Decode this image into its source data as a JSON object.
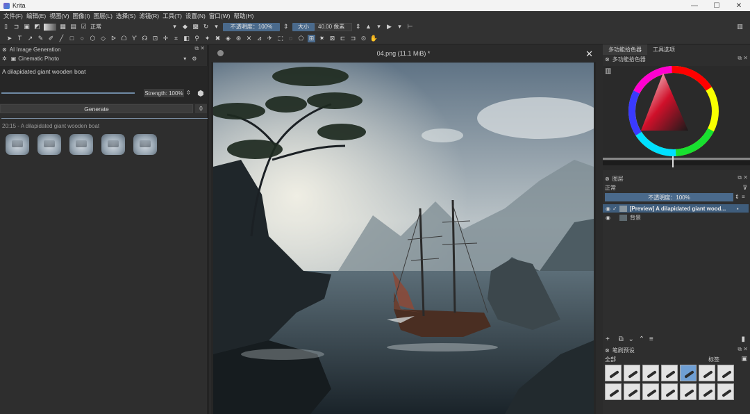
{
  "window": {
    "title": "Krita",
    "minimize": "—",
    "maximize": "☐",
    "close": "✕"
  },
  "menu": [
    "文件(F)",
    "编辑(E)",
    "视图(V)",
    "图像(I)",
    "图层(L)",
    "选择(S)",
    "滤镜(R)",
    "工具(T)",
    "设置(N)",
    "窗口(W)",
    "帮助(H)"
  ],
  "toolbar": {
    "blend_mode": "正常",
    "opacity_label": "不透明度：100%",
    "size_label": "大小",
    "size_value": "40.00 像素"
  },
  "ai_panel": {
    "title": "AI Image Generation",
    "style": "Cinematic Photo",
    "prompt": "A dilapidated giant wooden boat",
    "strength_label": "Strength: 100%",
    "generate_label": "Generate",
    "queue_count": "0",
    "history_label": "20:15 - A dilapidated giant wooden boat"
  },
  "document": {
    "tab_title": "04.png (11.1 MiB) *"
  },
  "right_panel": {
    "tab1": "多功能拾色器",
    "tab2": "工具选项",
    "selector_title": "多功能拾色器",
    "layers_title": "图层",
    "blend_mode": "正常",
    "opacity": "不透明度：100%",
    "layer1": "[Preview] A dilapidated giant wood...",
    "layer2": "背景",
    "brush_title": "笔刷预设",
    "brush_filter": "全部",
    "brush_tag": "标签"
  },
  "colors": {
    "accent": "#4a6a8c",
    "panel": "#2e2e2e",
    "selected_layer": "#3f5d7c"
  }
}
